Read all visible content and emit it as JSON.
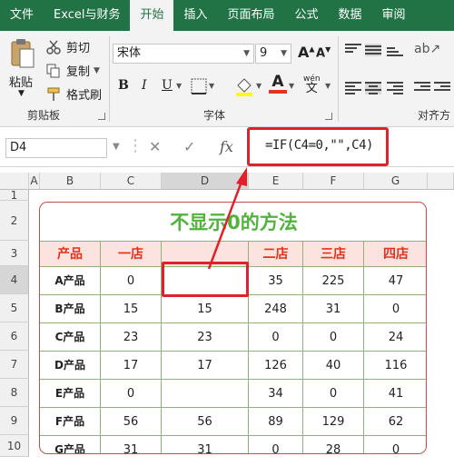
{
  "ribbon": {
    "tabs": [
      "文件",
      "Excel与财务",
      "开始",
      "插入",
      "页面布局",
      "公式",
      "数据",
      "审阅"
    ],
    "active_tab": "开始",
    "clipboard": {
      "paste_label": "粘贴",
      "cut_label": "剪切",
      "copy_label": "复制",
      "format_painter_label": "格式刷",
      "group_label": "剪贴板"
    },
    "font": {
      "font_name": "宋体",
      "font_size": "9",
      "group_label": "字体",
      "bold": "B",
      "italic": "I",
      "underline": "U",
      "grow": "A",
      "shrink": "A",
      "phonetic": "wén"
    },
    "alignment": {
      "group_label": "对齐方"
    }
  },
  "formula_bar": {
    "name_box": "D4",
    "cancel": "✕",
    "enter": "✓",
    "fx": "fx",
    "formula": "=IF(C4=0,\"\",C4)"
  },
  "sheet": {
    "columns": [
      "A",
      "B",
      "C",
      "D",
      "E",
      "F",
      "G"
    ],
    "rows": [
      "1",
      "2",
      "3",
      "4",
      "5",
      "6",
      "7",
      "8",
      "9",
      "10"
    ],
    "title": "不显示0的方法",
    "headers": [
      "产品",
      "一店",
      "",
      "二店",
      "三店",
      "四店"
    ],
    "data": [
      [
        "A产品",
        "0",
        "",
        "35",
        "225",
        "47"
      ],
      [
        "B产品",
        "15",
        "15",
        "248",
        "31",
        "0"
      ],
      [
        "C产品",
        "23",
        "23",
        "0",
        "0",
        "24"
      ],
      [
        "D产品",
        "17",
        "17",
        "126",
        "40",
        "116"
      ],
      [
        "E产品",
        "0",
        "",
        "34",
        "0",
        "41"
      ],
      [
        "F产品",
        "56",
        "56",
        "89",
        "129",
        "62"
      ],
      [
        "G产品",
        "31",
        "31",
        "0",
        "28",
        "0"
      ]
    ]
  },
  "colors": {
    "ribbon_green": "#217346",
    "title_green": "#50b33c",
    "header_red": "#e2311d",
    "header_fill": "#fde3e0",
    "highlight_red": "#e0212b"
  }
}
